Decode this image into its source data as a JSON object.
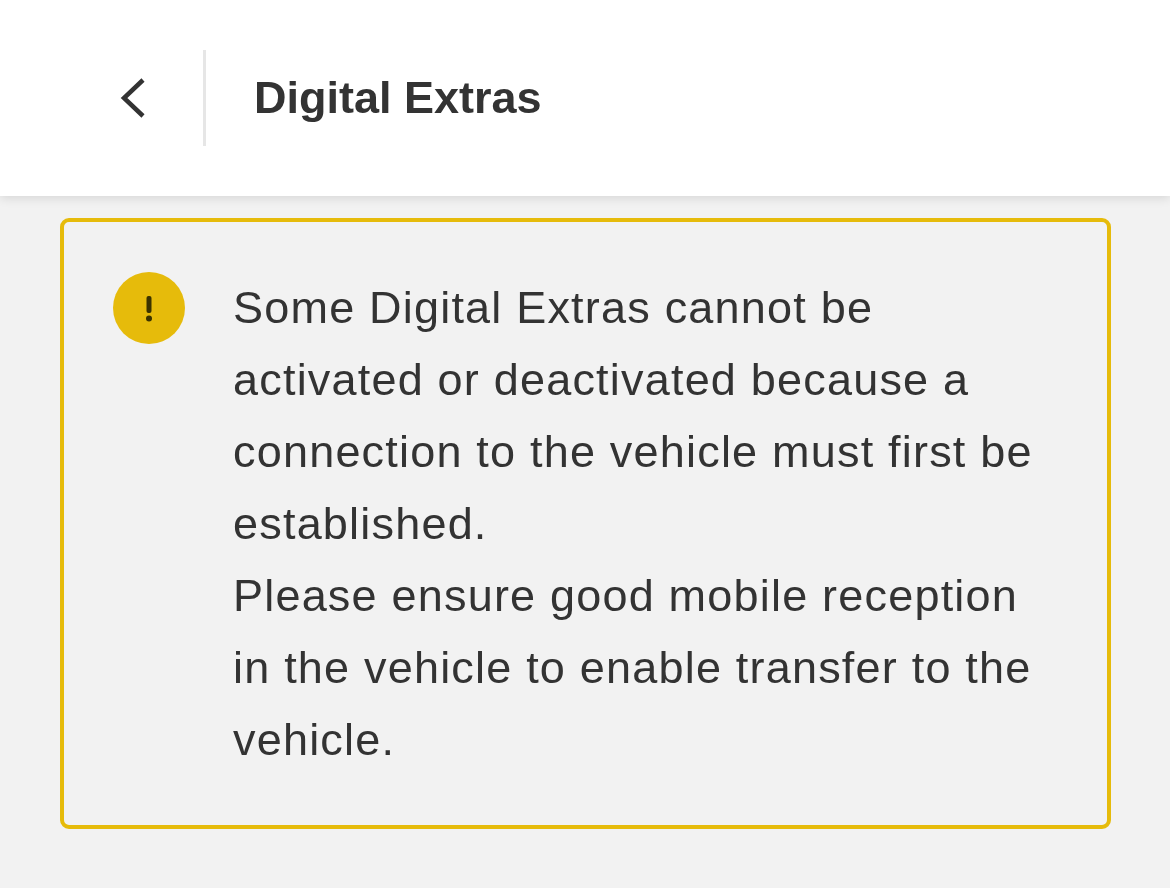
{
  "header": {
    "title": "Digital Extras"
  },
  "notice": {
    "kind": "warning",
    "paragraphs": [
      "Some Digital Extras cannot be activated or deactivated because a connection to the vehicle must first be established.",
      "Please ensure good mobile reception in the vehicle to enable transfer to the vehicle."
    ]
  }
}
